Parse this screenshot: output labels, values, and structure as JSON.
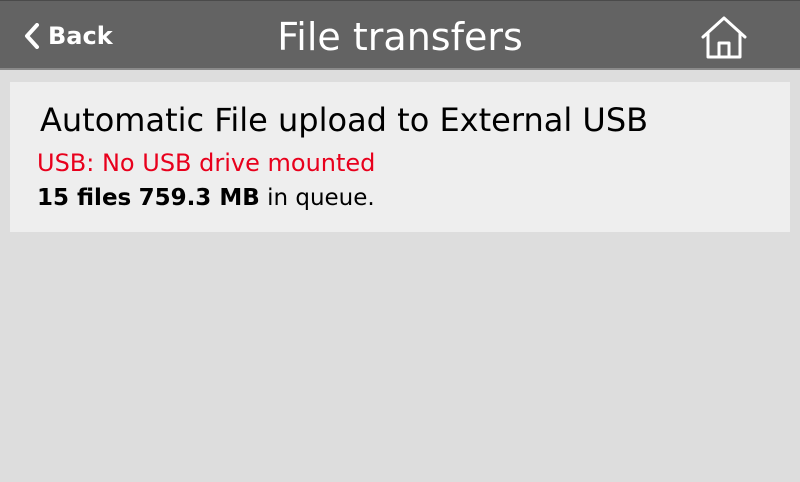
{
  "header": {
    "back_label": "Back",
    "title": "File transfers",
    "back_icon": "chevron-left-icon",
    "home_icon": "home-icon",
    "bar_color": "#636363"
  },
  "card": {
    "title": "Automatic File upload to External USB",
    "usb_status": "USB: No USB drive mounted",
    "usb_status_color": "#e8001c",
    "queue_files": "15 files",
    "queue_size": "759.3 MB",
    "queue_suffix": "in queue."
  }
}
